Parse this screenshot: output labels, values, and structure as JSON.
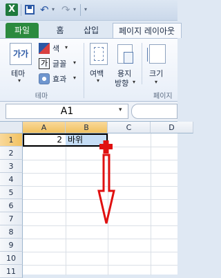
{
  "qat": {
    "app_icon_letter": "X",
    "undo_glyph": "↶",
    "undo_dropdown": "▾",
    "redo_glyph": "↷",
    "redo_dropdown": "▾",
    "customize_glyph": "▾"
  },
  "tabs": {
    "file": "파일",
    "home": "홈",
    "insert": "삽입",
    "page_layout": "페이지 레이아웃"
  },
  "ribbon": {
    "themes_button": "테마",
    "themes_icon_text": "가가",
    "colors": "색",
    "fonts": "글꼴",
    "fonts_icon_text": "가",
    "effects": "효과",
    "group_themes": "테마",
    "margins": "여백",
    "orientation_line1": "용지",
    "orientation_line2": "방향",
    "size": "크기",
    "group_page_setup": "페이지",
    "dropdown_glyph": "▾"
  },
  "formula_bar": {
    "name_box": "A1",
    "name_box_dropdown": "▾"
  },
  "sheet": {
    "columns": [
      "A",
      "B",
      "C",
      "D"
    ],
    "rows": [
      "1",
      "2",
      "3",
      "4",
      "5",
      "6",
      "7",
      "8",
      "9",
      "10",
      "11"
    ],
    "cells": {
      "A1": "2",
      "B1": "바위"
    }
  },
  "colors": {
    "selection_fill": "#c5ddf5",
    "arrow_red": "#e01010",
    "file_tab_green": "#2b8a3e"
  }
}
